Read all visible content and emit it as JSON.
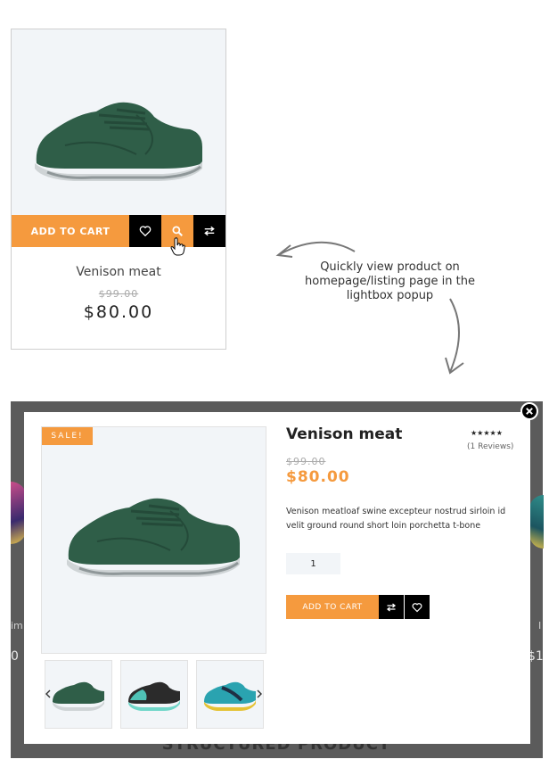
{
  "card": {
    "add_to_cart": "ADD TO CART",
    "title": "Venison meat",
    "old_price": "$99.00",
    "price": "$80.00",
    "icons": [
      "heart-icon",
      "search-icon",
      "compare-icon"
    ]
  },
  "annotation": {
    "text": "Quickly view product on homepage/listing page in the lightbox popup"
  },
  "background": {
    "heading": "STRUCTURED PRODUCT",
    "left_text": "im",
    "left_num": "0",
    "right_text": "I",
    "right_num": "$1"
  },
  "popup": {
    "sale_badge": "SALE!",
    "title": "Venison meat",
    "stars": "★★★★★",
    "reviews": "(1 Reviews)",
    "old_price": "$99.00",
    "price": "$80.00",
    "description": "Venison meatloaf swine excepteur nostrud sirloin id velit ground round short loin porchetta t-bone",
    "quantity": "1",
    "add_to_cart": "ADD TO CART",
    "thumbnails": [
      "green-shoe",
      "teal-black-shoe",
      "teal-yellow-shoe"
    ]
  },
  "colors": {
    "accent": "#f59a3e",
    "dark": "#000000",
    "overlay": "#5b5b5b",
    "shoe_green": "#2f5e48"
  }
}
